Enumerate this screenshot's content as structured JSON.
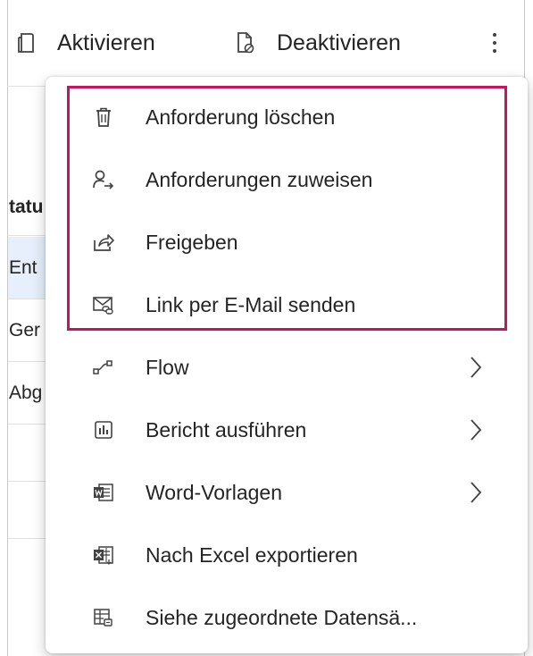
{
  "toolbar": {
    "activate_label": "Aktivieren",
    "deactivate_label": "Deaktivieren",
    "activate_icon": "document-icon",
    "deactivate_icon": "document-deactivate-icon",
    "more_icon": "more-vertical-icon"
  },
  "grid": {
    "column_header": "tatu",
    "rows": [
      "Ent",
      "Ger",
      "Abg"
    ]
  },
  "menu": {
    "items": [
      {
        "label": "Anforderung löschen",
        "icon": "trash-icon",
        "submenu": false
      },
      {
        "label": "Anforderungen zuweisen",
        "icon": "assign-person-icon",
        "submenu": false
      },
      {
        "label": "Freigeben",
        "icon": "share-icon",
        "submenu": false
      },
      {
        "label": "Link per E-Mail senden",
        "icon": "email-link-icon",
        "submenu": false
      },
      {
        "label": "Flow",
        "icon": "flow-icon",
        "submenu": true
      },
      {
        "label": "Bericht ausführen",
        "icon": "report-icon",
        "submenu": true
      },
      {
        "label": "Word-Vorlagen",
        "icon": "word-icon",
        "submenu": true
      },
      {
        "label": "Nach Excel exportieren",
        "icon": "excel-icon",
        "submenu": false
      },
      {
        "label": "Siehe zugeordnete Datensä...",
        "icon": "related-records-icon",
        "submenu": false
      }
    ]
  },
  "colors": {
    "highlight": "#c8145a",
    "selected_row": "#e6effb",
    "text": "#242424",
    "icon": "#424242"
  }
}
